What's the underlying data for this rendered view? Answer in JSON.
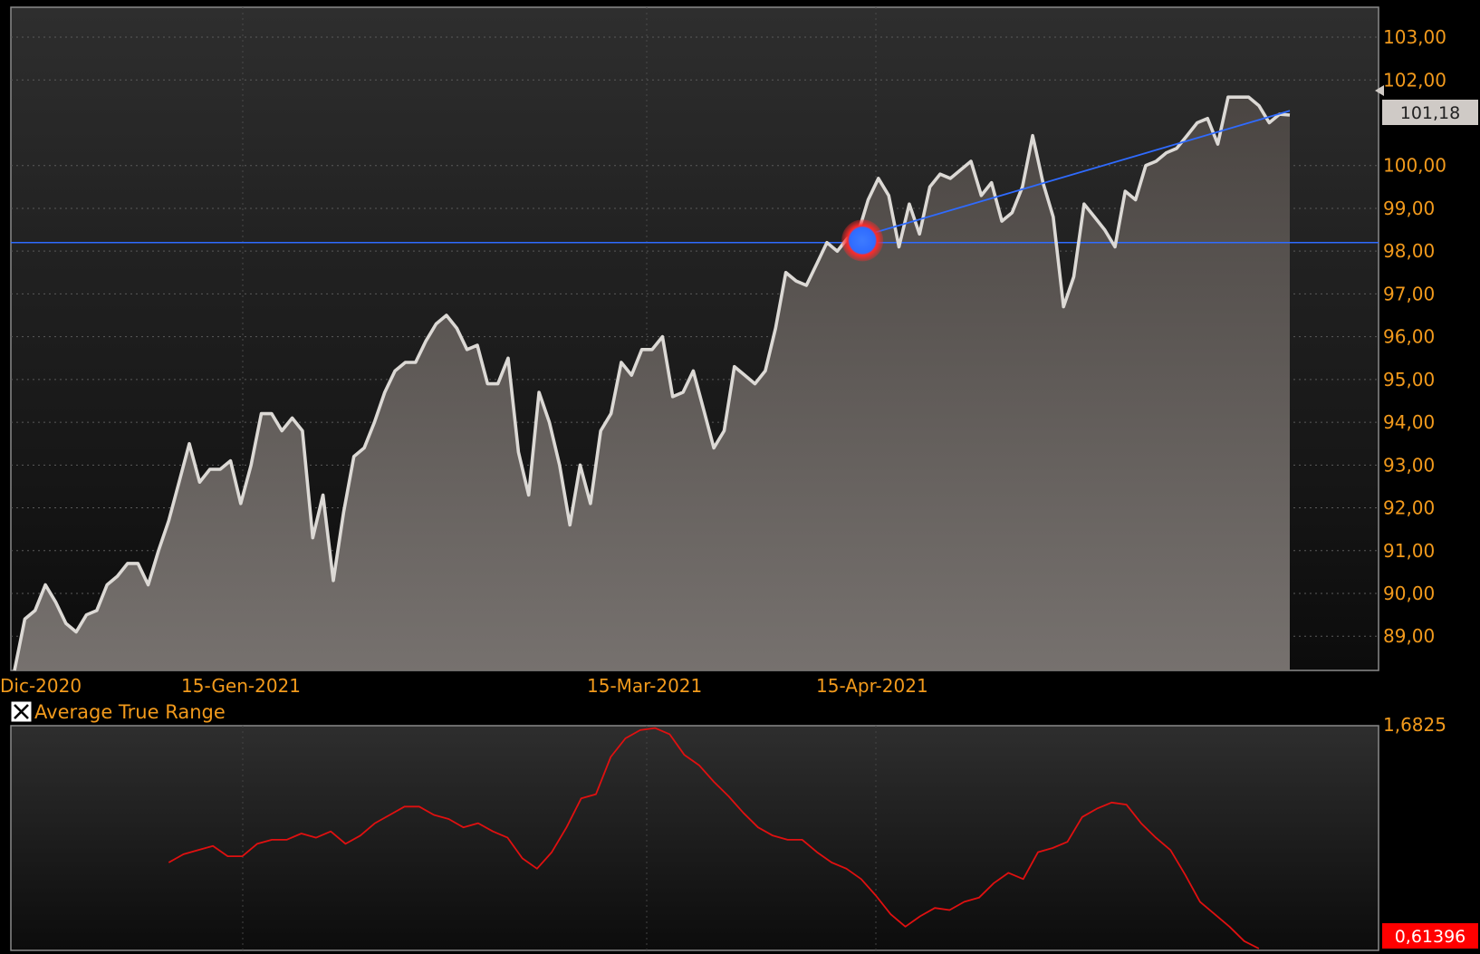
{
  "colors": {
    "background": "#000000",
    "axis_text": "#f29a1c",
    "price_line": "#d9d6d2",
    "trend_line": "#2f6bff",
    "atr_line": "#e01010",
    "atr_badge": "#ff0000",
    "price_badge": "#cfcac6"
  },
  "chart_data": [
    {
      "type": "area",
      "x_ticks": [
        "Dic-2020",
        "15-Gen-2021",
        "15-Mar-2021",
        "15-Apr-2021"
      ],
      "y_ticks": [
        "89,00",
        "90,00",
        "91,00",
        "92,00",
        "93,00",
        "94,00",
        "95,00",
        "96,00",
        "97,00",
        "98,00",
        "99,00",
        "100,00",
        "102,00",
        "103,00"
      ],
      "ylim": [
        88.2,
        103.7
      ],
      "last_value_label": "101,18",
      "horizontal_line": 98.2,
      "trend_line": {
        "from": [
          125,
          98.35
        ],
        "to": [
          188,
          101.28
        ]
      },
      "marker": {
        "x": 125,
        "y": 98.25
      },
      "grid": true,
      "values": [
        88.2,
        89.4,
        89.6,
        90.2,
        89.8,
        89.3,
        89.1,
        89.5,
        89.6,
        90.2,
        90.4,
        90.7,
        90.7,
        90.2,
        91.0,
        91.7,
        92.6,
        93.5,
        92.6,
        92.9,
        92.9,
        93.1,
        92.1,
        93.0,
        94.2,
        94.2,
        93.8,
        94.1,
        93.8,
        91.3,
        92.3,
        90.3,
        91.9,
        93.2,
        93.4,
        94.0,
        94.7,
        95.2,
        95.4,
        95.4,
        95.9,
        96.3,
        96.5,
        96.2,
        95.7,
        95.8,
        94.9,
        94.9,
        95.5,
        93.3,
        92.3,
        94.7,
        94.0,
        93.0,
        91.6,
        93.0,
        92.1,
        93.8,
        94.2,
        95.4,
        95.1,
        95.7,
        95.7,
        96.0,
        94.6,
        94.7,
        95.2,
        94.3,
        93.4,
        93.8,
        95.3,
        95.1,
        94.9,
        95.2,
        96.2,
        97.5,
        97.3,
        97.2,
        97.7,
        98.2,
        98.0,
        98.3,
        98.4,
        99.2,
        99.7,
        99.3,
        98.1,
        99.1,
        98.4,
        99.5,
        99.8,
        99.7,
        99.9,
        100.1,
        99.3,
        99.6,
        98.7,
        98.9,
        99.5,
        100.7,
        99.6,
        98.8,
        96.7,
        97.4,
        99.1,
        98.8,
        98.5,
        98.1,
        99.4,
        99.2,
        100.0,
        100.1,
        100.3,
        100.4,
        100.7,
        101.0,
        101.1,
        100.5,
        101.6,
        101.6,
        101.6,
        101.4,
        101.0,
        101.2,
        101.18
      ],
      "x_positions": [
        0,
        1,
        2,
        3,
        4,
        5,
        6,
        7,
        8,
        9,
        10,
        11,
        12,
        13,
        14,
        15,
        16,
        17,
        18,
        19,
        20,
        21,
        22,
        23,
        24,
        25,
        26,
        27,
        28,
        29,
        30,
        31,
        32,
        33,
        34,
        35,
        36,
        37,
        38,
        39,
        40,
        41,
        42,
        43,
        44,
        45,
        46,
        47,
        48,
        49,
        50,
        51,
        52,
        53,
        54,
        55,
        56,
        57,
        58,
        59,
        60,
        61,
        62,
        63,
        64,
        65,
        66,
        67,
        68,
        69,
        70,
        71,
        72,
        73,
        74,
        75,
        76,
        77,
        78,
        79,
        80,
        81,
        82,
        83,
        84,
        85,
        86,
        87,
        88,
        89,
        90,
        91,
        92,
        93,
        94,
        95,
        96,
        97,
        98,
        99,
        100,
        101,
        102,
        103,
        104,
        105,
        106,
        107,
        108,
        109,
        110,
        111,
        112,
        113,
        114,
        115,
        116,
        117,
        118,
        119,
        120,
        121,
        122,
        123,
        124
      ],
      "x_index_scale": 1.52
    },
    {
      "type": "line",
      "title": "Average True Range",
      "y_ticks": [
        "1,6825"
      ],
      "ylim": [
        0.61396,
        1.6825
      ],
      "last_value_label": "0,61396",
      "values": [
        1.03,
        1.07,
        1.09,
        1.11,
        1.06,
        1.06,
        1.12,
        1.14,
        1.14,
        1.17,
        1.15,
        1.18,
        1.12,
        1.16,
        1.22,
        1.26,
        1.3,
        1.3,
        1.26,
        1.24,
        1.2,
        1.22,
        1.18,
        1.15,
        1.05,
        1.0,
        1.08,
        1.2,
        1.34,
        1.36,
        1.54,
        1.63,
        1.67,
        1.68,
        1.65,
        1.55,
        1.5,
        1.42,
        1.35,
        1.27,
        1.2,
        1.16,
        1.14,
        1.14,
        1.08,
        1.03,
        1.0,
        0.95,
        0.87,
        0.78,
        0.72,
        0.77,
        0.81,
        0.8,
        0.84,
        0.86,
        0.93,
        0.98,
        0.95,
        1.08,
        1.1,
        1.13,
        1.25,
        1.29,
        1.32,
        1.31,
        1.22,
        1.15,
        1.09,
        0.97,
        0.84,
        0.78,
        0.72,
        0.65,
        0.61396
      ],
      "x_start_index": 15,
      "x_end_index": 121
    }
  ]
}
